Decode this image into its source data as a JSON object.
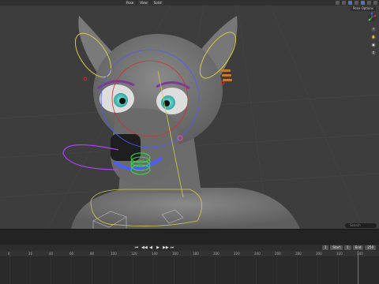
{
  "topbar": {
    "mode_label": "Pose",
    "shading": "Solid",
    "menu_view": "View",
    "pose_options": "Pose Options"
  },
  "navigation": {
    "zoom_label": "+",
    "pan_label": "✋",
    "camera_label": "▣",
    "ortho_label": "⌗"
  },
  "timeline": {
    "search_placeholder": "Search",
    "current_frame": "1",
    "start_label": "Start",
    "start_value": "1",
    "end_label": "End",
    "end_value": "250",
    "controls": [
      "⏮",
      "◀◀",
      "◀",
      "▶",
      "▶▶",
      "⏭"
    ],
    "ruler_ticks": [
      "0",
      "20",
      "40",
      "60",
      "80",
      "100",
      "120",
      "140",
      "160",
      "180",
      "200",
      "220",
      "240",
      "260",
      "280",
      "300",
      "320",
      "340"
    ]
  },
  "colors": {
    "accent": "#4d79b3",
    "bone_yellow": "#d8c84a",
    "bone_blue": "#4a5cff",
    "bone_green": "#3dd84a",
    "bone_red": "#d03030",
    "bone_purple": "#b040ff"
  }
}
